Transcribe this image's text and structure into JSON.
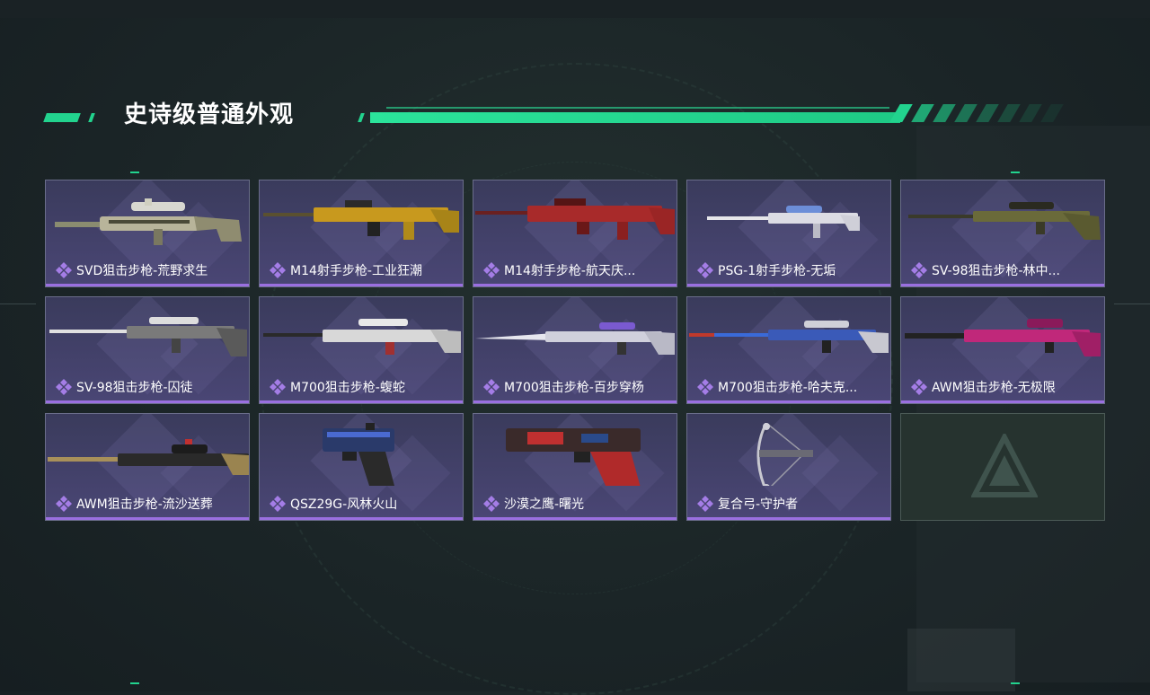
{
  "header": {
    "title": "史诗级普通外观"
  },
  "colors": {
    "accent": "#22d38e",
    "rarity_epic": "#9a6fe0",
    "card_bg": "#3f3f63"
  },
  "items": [
    {
      "name": "SVD狙击步枪-荒野求生",
      "icon": "sniper-rifle-icon"
    },
    {
      "name": "M14射手步枪-工业狂潮",
      "icon": "marksman-rifle-icon"
    },
    {
      "name": "M14射手步枪-航天庆...",
      "icon": "marksman-rifle-icon"
    },
    {
      "name": "PSG-1射手步枪-无垢",
      "icon": "marksman-rifle-icon"
    },
    {
      "name": "SV-98狙击步枪-林中...",
      "icon": "sniper-rifle-icon"
    },
    {
      "name": "SV-98狙击步枪-囚徒",
      "icon": "sniper-rifle-icon"
    },
    {
      "name": "M700狙击步枪-蝮蛇",
      "icon": "sniper-rifle-icon"
    },
    {
      "name": "M700狙击步枪-百步穿杨",
      "icon": "sniper-rifle-icon"
    },
    {
      "name": "M700狙击步枪-哈夫克...",
      "icon": "sniper-rifle-icon"
    },
    {
      "name": "AWM狙击步枪-无极限",
      "icon": "sniper-rifle-icon"
    },
    {
      "name": "AWM狙击步枪-流沙送葬",
      "icon": "sniper-rifle-icon"
    },
    {
      "name": "QSZ29G-风林火山",
      "icon": "pistol-icon"
    },
    {
      "name": "沙漠之鹰-曙光",
      "icon": "pistol-icon"
    },
    {
      "name": "复合弓-守护者",
      "icon": "compound-bow-icon"
    }
  ],
  "empty_slot": {
    "icon": "game-logo-icon"
  }
}
